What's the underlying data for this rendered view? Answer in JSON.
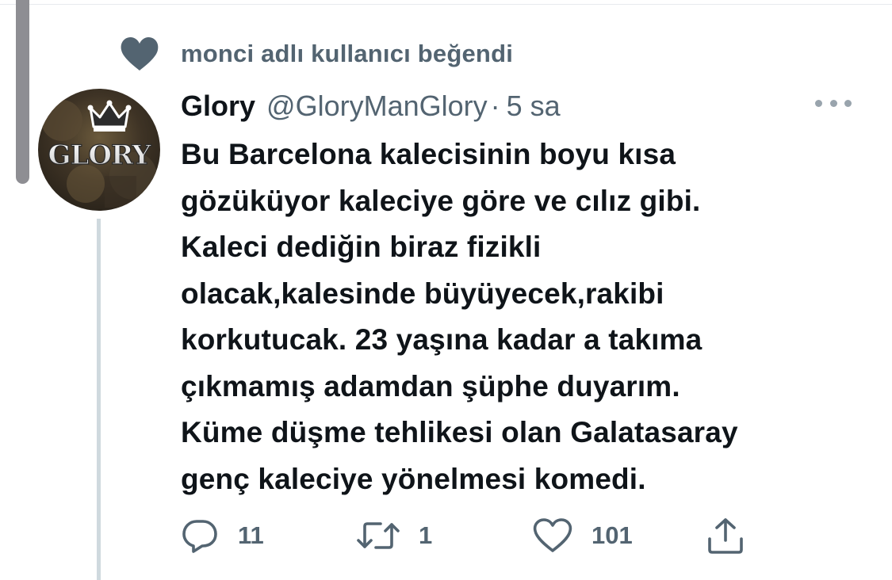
{
  "social_context": {
    "text": "monci adlı kullanıcı beğendi",
    "icon": "heart-icon"
  },
  "tweet": {
    "display_name": "Glory",
    "handle": "@GloryManGlory",
    "separator": "·",
    "timestamp": "5 sa",
    "avatar_text": "GLORY",
    "lines": [
      "Bu Barcelona kalecisinin boyu kısa",
      "gözüküyor kaleciye göre ve cılız gibi.",
      "Kaleci dediğin biraz fizikli",
      "olacak,kalesinde büyüyecek,rakibi",
      "korkutucak. 23 yaşına kadar a takıma",
      "çıkmamış adamdan şüphe duyarım.",
      "Küme düşme tehlikesi olan Galatasaray",
      "genç kaleciye yönelmesi komedi."
    ]
  },
  "actions": {
    "reply_count": "11",
    "retweet_count": "1",
    "like_count": "101"
  },
  "colors": {
    "text_primary": "#0f1419",
    "text_secondary": "#536471",
    "heart_context": "#536471",
    "thread_line": "#cfd9de",
    "scrollbar": "#8e8e93"
  }
}
